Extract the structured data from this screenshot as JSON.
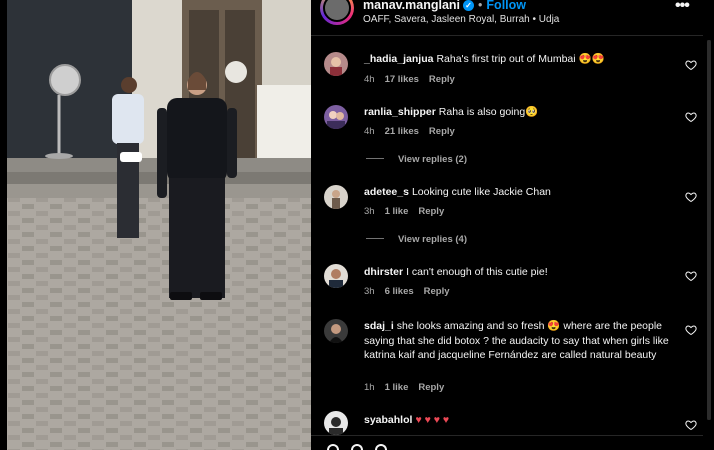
{
  "post": {
    "username": "manav.manglani",
    "verified_mark": "✓",
    "separator": "•",
    "follow_label": "Follow",
    "location": "OAFF, Savera, Jasleen Royal, Burrah • Udja",
    "more_label": "•••"
  },
  "comments": [
    {
      "user": "_hadia_janjua",
      "text": "Raha's first trip out of Mumbai 😍😍",
      "time": "4h",
      "likes": "17 likes",
      "reply": "Reply"
    },
    {
      "user": "ranlia_shipper",
      "text": "Raha is also going🥺",
      "time": "4h",
      "likes": "21 likes",
      "reply": "Reply",
      "view_replies": "View replies (2)"
    },
    {
      "user": "adetee_s",
      "text": "Looking cute like Jackie Chan",
      "time": "3h",
      "likes": "1 like",
      "reply": "Reply",
      "view_replies": "View replies (4)"
    },
    {
      "user": "dhirster",
      "text": "I can't enough of this cutie pie!",
      "time": "3h",
      "likes": "6 likes",
      "reply": "Reply"
    },
    {
      "user": "sdaj_i",
      "text": "she looks amazing and so fresh 😍 where are the people saying that she did botox ? the audacity to say that when girls like katrina kaif and jacqueline Fernández are called natural beauty",
      "time": "1h",
      "likes": "1 like",
      "reply": "Reply"
    },
    {
      "user": "syabahlol",
      "text": "♥ ♥ ♥ ♥"
    }
  ],
  "colors": {
    "accent": "#0095f6",
    "muted": "#a8a8a8",
    "background": "#000000",
    "heart_red": "#ed4956"
  },
  "icons": [
    "verified-badge-icon",
    "more-options-icon",
    "heart-icon",
    "like-icon",
    "comment-icon",
    "share-icon"
  ]
}
